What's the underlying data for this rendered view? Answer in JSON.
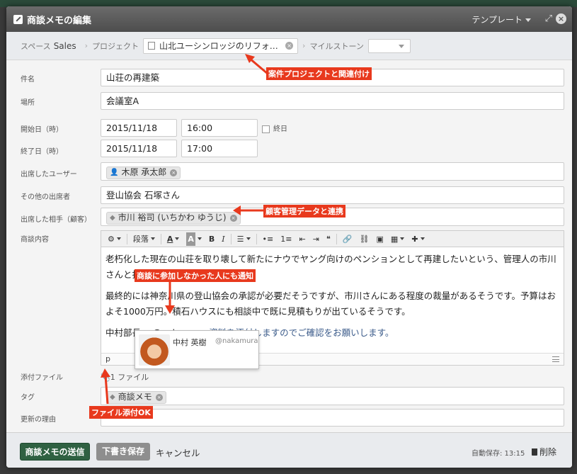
{
  "dialog": {
    "title": "商談メモの編集",
    "template_label": "テンプレート",
    "close_glyph": "×",
    "expand_glyph": "⤢"
  },
  "breadcrumb": {
    "space_label": "スペース",
    "space_value": "Sales",
    "project_label": "プロジェクト",
    "project_value": "山北ユーシンロッジのリフォ…",
    "milestone_label": "マイルストーン",
    "milestone_value": ""
  },
  "fields": {
    "subject_label": "件名",
    "subject_value": "山荘の再建築",
    "place_label": "場所",
    "place_value": "会議室A",
    "start_label": "開始日（時）",
    "start_date": "2015/11/18",
    "start_time": "16:00",
    "allday_label": "終日",
    "end_label": "終了日（時）",
    "end_date": "2015/11/18",
    "end_time": "17:00",
    "attendees_label": "出席したユーザー",
    "attendee_user": "木原 承太郎",
    "others_label": "その他の出席者",
    "others_value": "登山協会 石塚さん",
    "client_label": "出席した相手（顧客）",
    "client_value": "市川 裕司 (いちかわ ゆうじ)",
    "content_label": "商談内容",
    "attachments_label": "添付ファイル",
    "attachments_value": "1 ファイル",
    "tags_label": "タグ",
    "tag_value": "商談メモ",
    "reason_label": "更新の理由",
    "reason_value": ""
  },
  "editor": {
    "paragraph_menu": "段落",
    "para1": "老朽化した現在の山荘を取り壊して新たにナウでヤング向けのペンションとして再建したいという、管理人の市川さんと打ち合わせしました。",
    "para2": "最終的には神奈川県の登山協会の承認が必要だそうですが、市川さんにある程度の裁量があるそうです。予算はおよそ1000万円。積石ハウスにも相談中で既に見積もりが出ているそうです。",
    "para3_prefix": "中村部長へ ",
    "para3_mention": "@nakamura",
    "para3_suffix": " 資料を添付しますのでご確認をお願いします。",
    "status_path": "p"
  },
  "mention_popup": {
    "name": "中村 英樹",
    "username": "@nakamura"
  },
  "footer": {
    "submit_label": "商談メモの送信",
    "draft_label": "下書き保存",
    "cancel_label": "キャンセル",
    "autosave_label": "自動保存: 13:15",
    "delete_label": "削除"
  },
  "annotations": {
    "project_link": "案件プロジェクトと関連付け",
    "customer_link": "顧客管理データと連携",
    "notify": "商談に参加しなかった人にも通知",
    "attach_ok": "ファイル添付OK"
  },
  "colors": {
    "accent_green": "#2f6142",
    "annotation_red": "#e8391d"
  }
}
